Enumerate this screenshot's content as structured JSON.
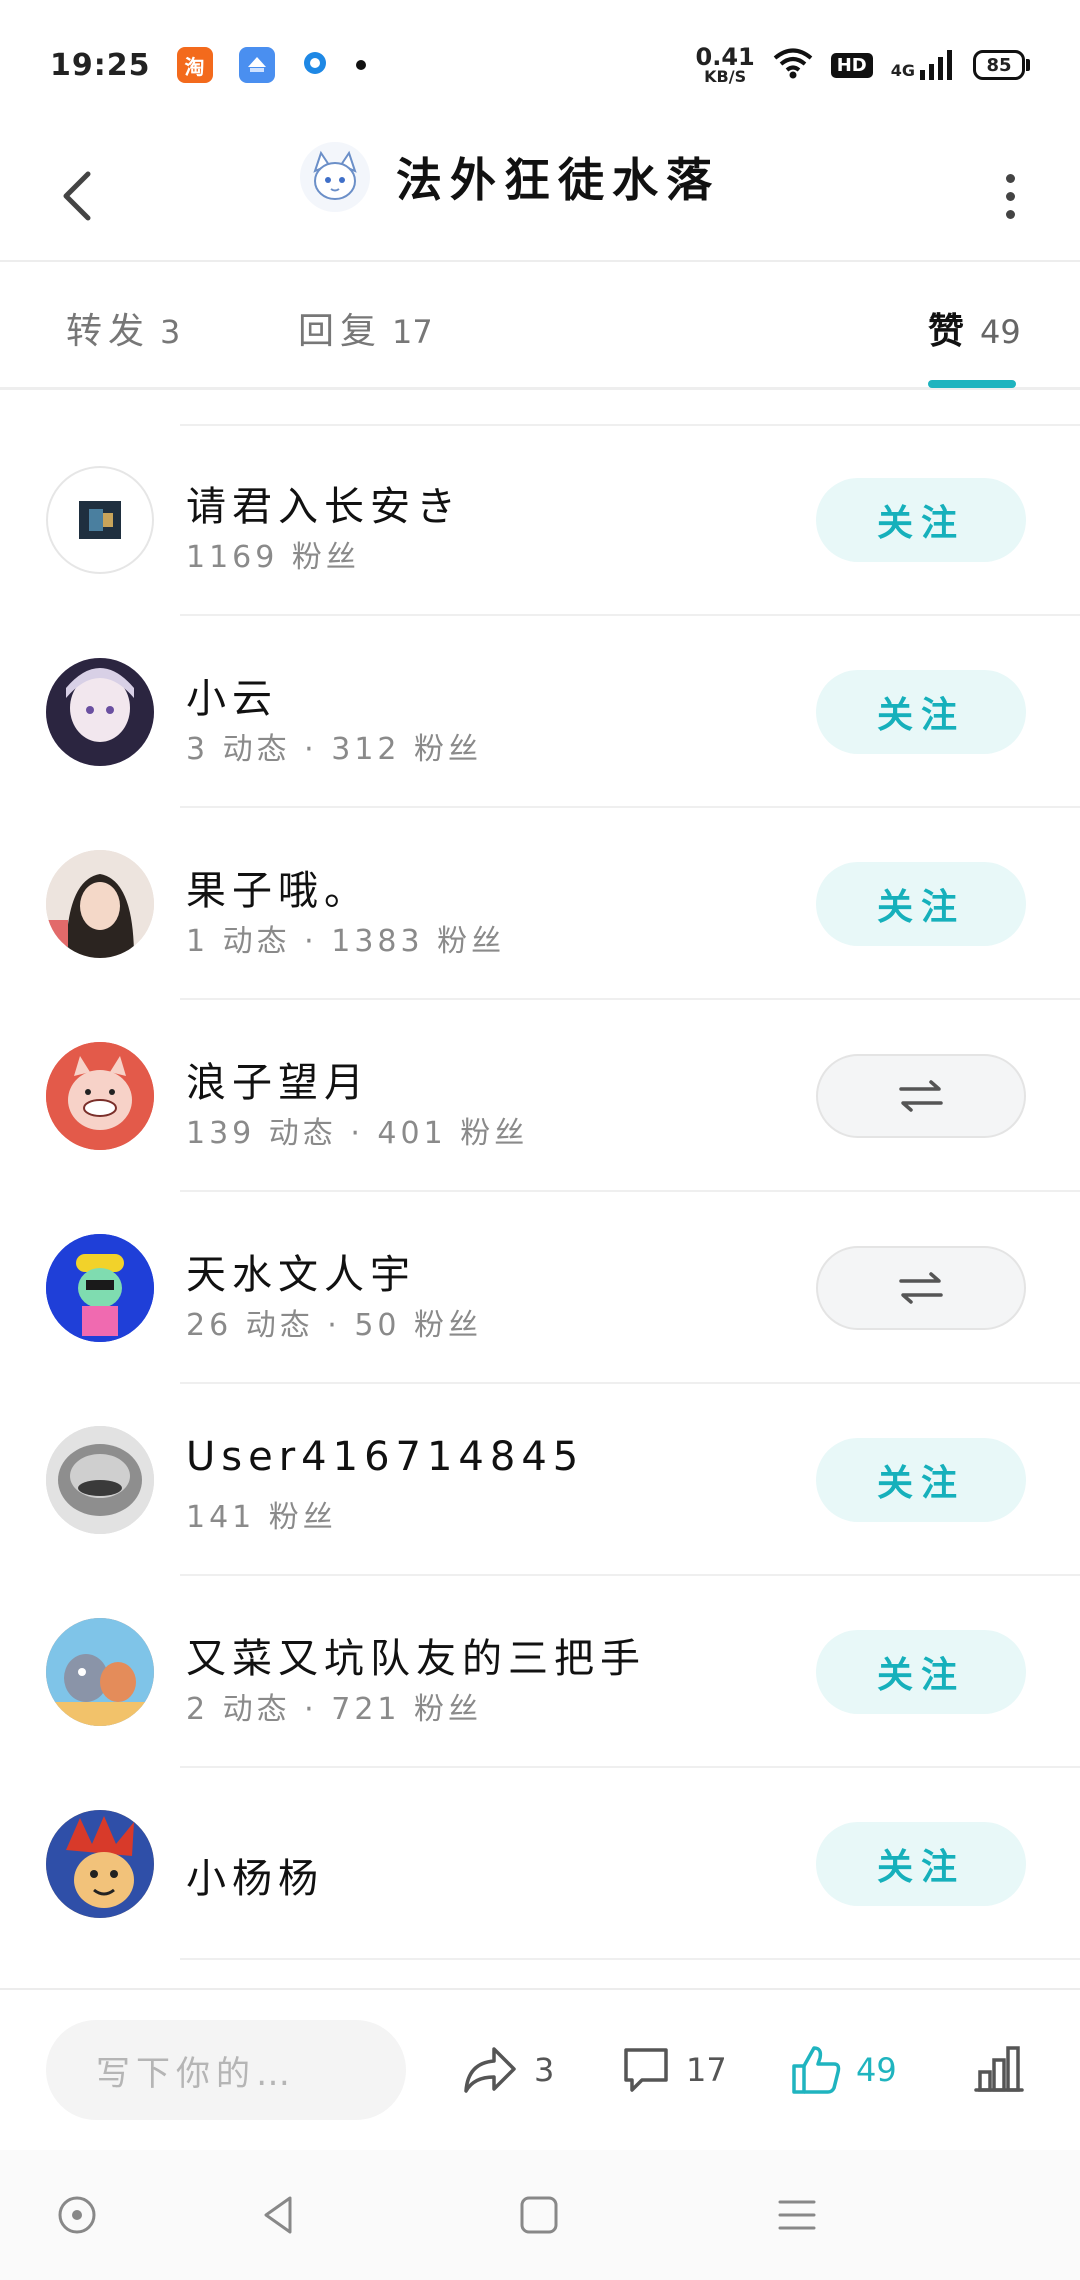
{
  "status_bar": {
    "time": "19:25",
    "net_speed_value": "0.41",
    "net_speed_unit": "KB/S",
    "hd_label": "HD",
    "network_label": "4G",
    "battery": "85"
  },
  "header": {
    "title": "法外狂徒水落"
  },
  "tabs": [
    {
      "label": "转发",
      "count": "3"
    },
    {
      "label": "回复",
      "count": "17"
    },
    {
      "label": "赞",
      "count": "49"
    }
  ],
  "users": [
    {
      "name": "请君入长安き",
      "meta": "1169 粉丝",
      "button": "关注",
      "avatar_color": "#1f2f3f"
    },
    {
      "name": "小云",
      "meta": "3 动态 · 312 粉丝",
      "button": "关注",
      "avatar_color": "#c9b4d6"
    },
    {
      "name": "果子哦。",
      "meta": "1 动态 · 1383 粉丝",
      "button": "关注",
      "avatar_color": "#d9a89a"
    },
    {
      "name": "浪子望月",
      "meta": "139 动态 · 401 粉丝",
      "button": "",
      "avatar_color": "#e35a4a"
    },
    {
      "name": "天水文人宇",
      "meta": "26 动态 · 50 粉丝",
      "button": "",
      "avatar_color": "#1f3fd8"
    },
    {
      "name": "User416714845",
      "meta": "141 粉丝",
      "button": "关注",
      "avatar_color": "#9a9a9a"
    },
    {
      "name": "又菜又坑队友的三把手",
      "meta": "2 动态 · 721 粉丝",
      "button": "关注",
      "avatar_color": "#e48c5a"
    },
    {
      "name": "小杨杨",
      "meta": "",
      "button": "关注",
      "avatar_color": "#e4a33a"
    }
  ],
  "bottom_bar": {
    "comment_placeholder": "写下你的…",
    "forward_count": "3",
    "reply_count": "17",
    "like_count": "49"
  },
  "colors": {
    "accent": "#1fb4bf",
    "follow_bg": "#e8f8f8"
  }
}
